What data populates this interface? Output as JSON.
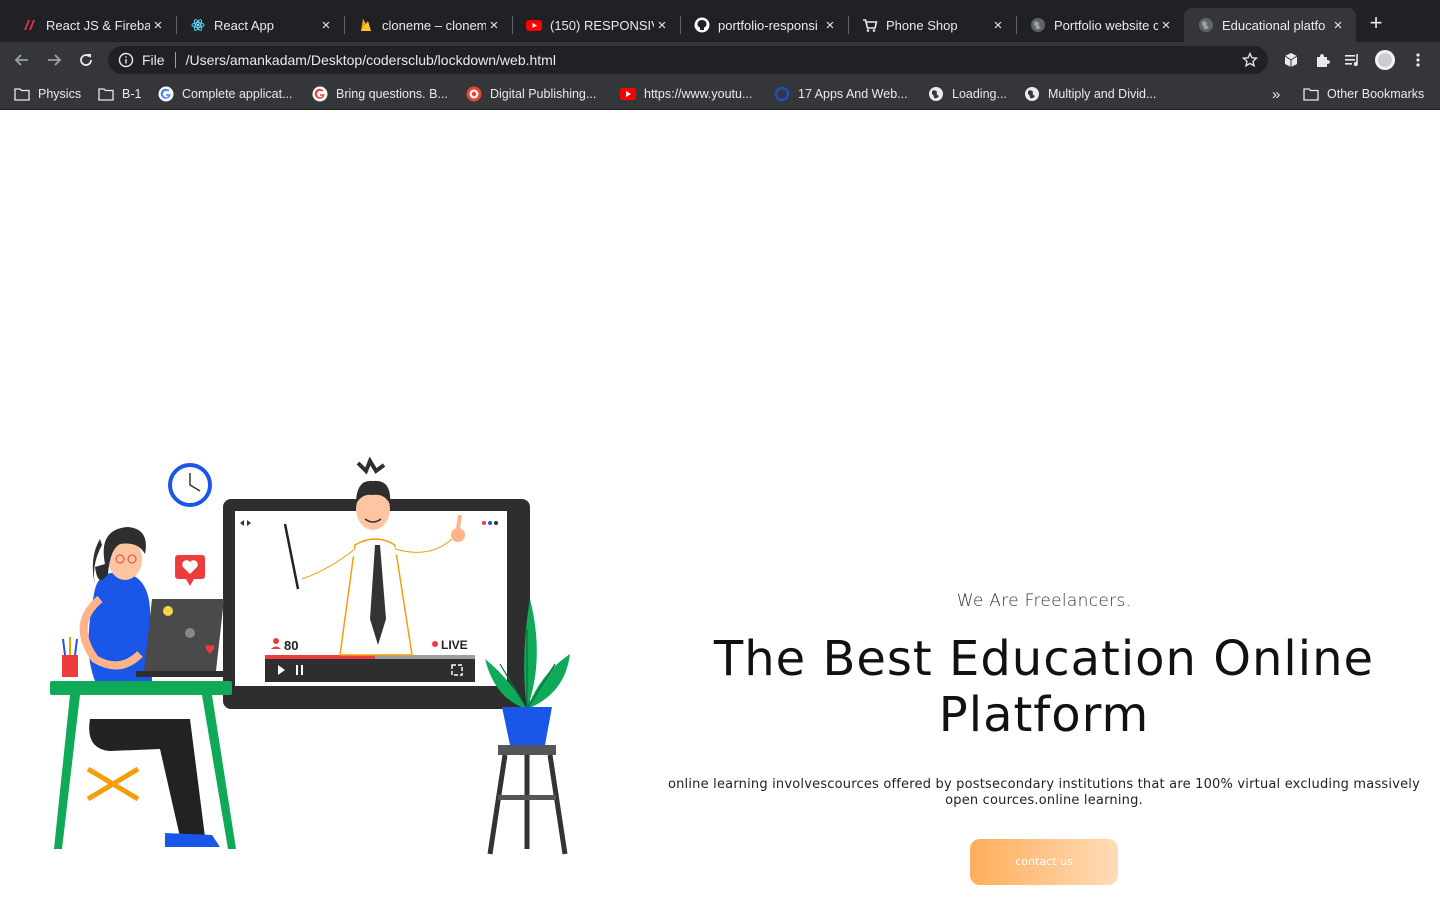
{
  "browser": {
    "tabs": [
      {
        "title": "React JS & Firebas",
        "icon": "udemy-icon"
      },
      {
        "title": "React App",
        "icon": "react-icon"
      },
      {
        "title": "cloneme – clonem",
        "icon": "firebase-icon"
      },
      {
        "title": "(150) RESPONSIVE",
        "icon": "youtube-icon"
      },
      {
        "title": "portfolio-responsi",
        "icon": "github-icon"
      },
      {
        "title": "Phone Shop",
        "icon": "cart-icon"
      },
      {
        "title": "Portfolio website c",
        "icon": "globe-icon"
      },
      {
        "title": "Educational platfo",
        "icon": "globe-icon",
        "active": true
      }
    ],
    "address": {
      "scheme": "File",
      "url": "/Users/amankadam/Desktop/codersclub/lockdown/web.html"
    },
    "bookmarks": [
      {
        "label": "Physics",
        "icon": "folder-icon"
      },
      {
        "label": "B-1",
        "icon": "folder-icon"
      },
      {
        "label": "Complete applicat...",
        "icon": "google-icon"
      },
      {
        "label": "Bring questions. B...",
        "icon": "google-icon"
      },
      {
        "label": "Digital Publishing...",
        "icon": "target-icon"
      },
      {
        "label": "https://www.youtu...",
        "icon": "youtube-icon"
      },
      {
        "label": "17 Apps And Web...",
        "icon": "circle-icon"
      },
      {
        "label": "Loading...",
        "icon": "globe-icon"
      },
      {
        "label": "Multiply and Divid...",
        "icon": "globe-icon"
      }
    ],
    "overflow_label": "»",
    "other_bookmarks": "Other Bookmarks"
  },
  "hero": {
    "eyebrow": "We Are Freelancers.",
    "headline": "The Best Education Online Platform",
    "description": "online learning involvescources offered by postsecondary institutions that are 100% virtual excluding massively open cources.online learning.",
    "cta_label": "contact us"
  },
  "illustration": {
    "viewer_count": "80",
    "live_label": "LIVE"
  },
  "colors": {
    "tab_bar": "#202124",
    "toolbar": "#35363a",
    "cta_start": "#ffad5a",
    "cta_end": "#ffdcb8",
    "green": "#0fa958",
    "blue": "#1a56e8"
  }
}
